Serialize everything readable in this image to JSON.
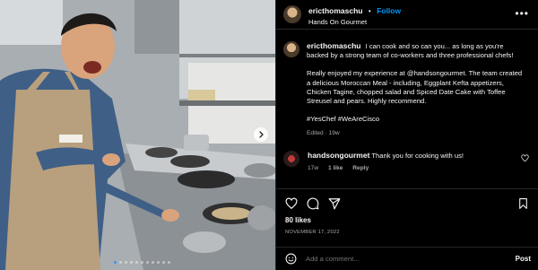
{
  "header": {
    "username": "ericthomaschu",
    "separator": "•",
    "follow_label": "Follow",
    "location": "Hands On Gourmet",
    "more_label": "•••"
  },
  "caption": {
    "username": "ericthomaschu",
    "para1": "I can cook and so can you... as long as you're backed by a strong team of co-workers and three professional chefs!",
    "para2": "Really enjoyed my experience at @handsongourmet. The team created a delicious Moroccan Meal - including, Eggplant Kefta appetizers, Chicken Tagine, chopped salad and Spiced Date Cake with Toffee Streusel and pears. Highly recommend.",
    "para3": "#YesChef #WeAreCisco",
    "meta": "Edited · 19w"
  },
  "reply": {
    "username": "handsongourmet",
    "text": "Thank you for cooking with us!",
    "age": "17w",
    "likes": "1 like",
    "reply_label": "Reply"
  },
  "actions": {
    "likes": "80 likes",
    "date": "NOVEMBER 17, 2022"
  },
  "comment_box": {
    "placeholder": "Add a comment...",
    "post_label": "Post"
  },
  "carousel": {
    "slide_count": 11,
    "active_index": 0
  },
  "colors": {
    "accent": "#0095f6",
    "background": "#000000",
    "secondary_text": "#a8a8a8",
    "divider": "#262626"
  },
  "icons": {
    "like": "heart-icon",
    "comment": "comment-icon",
    "share": "send-icon",
    "save": "bookmark-icon",
    "emoji": "emoji-icon",
    "next": "chevron-right-icon"
  }
}
